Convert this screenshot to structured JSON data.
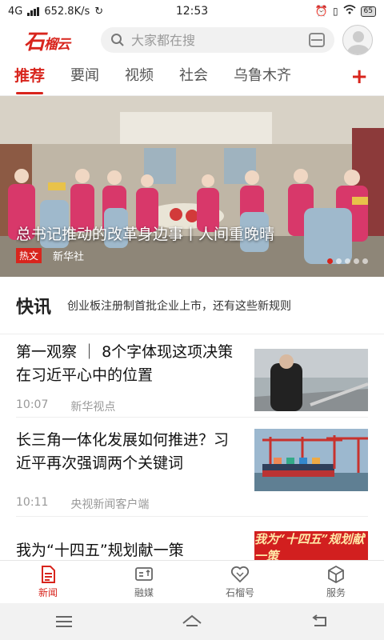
{
  "status_bar": {
    "network": "4G",
    "speed": "652.8K/s",
    "time": "12:53",
    "battery": "65"
  },
  "header": {
    "logo_main": "石",
    "logo_sub": "榴云",
    "search_placeholder": "大家都在搜"
  },
  "tabs": [
    {
      "label": "推荐",
      "active": true
    },
    {
      "label": "要闻"
    },
    {
      "label": "视频"
    },
    {
      "label": "社会"
    },
    {
      "label": "乌鲁木齐"
    }
  ],
  "tabs_add": "+",
  "banner": {
    "title": "总书记推动的改革身边事丨人间重晚晴",
    "tag": "热文",
    "source": "新华社"
  },
  "flash": {
    "label": "快讯",
    "text": "创业板注册制首批企业上市，还有这些新规则"
  },
  "news": [
    {
      "title": "第一观察 ｜ 8个字体现这项决策在习近平心中的位置",
      "time": "10:07",
      "source": "新华视点"
    },
    {
      "title": "长三角一体化发展如何推进？习近平再次强调两个关键词",
      "time": "10:11",
      "source": "央视新闻客户端"
    },
    {
      "title": "我为“十四五”规划献一策",
      "thumb_text": "我为“十四五”规划献一策"
    }
  ],
  "bottom_nav": [
    {
      "label": "新闻",
      "icon": "news-icon",
      "active": true
    },
    {
      "label": "融媒",
      "icon": "media-icon"
    },
    {
      "label": "石榴号",
      "icon": "heart-icon"
    },
    {
      "label": "服务",
      "icon": "box-icon"
    }
  ],
  "colors": {
    "accent": "#d8251d"
  }
}
